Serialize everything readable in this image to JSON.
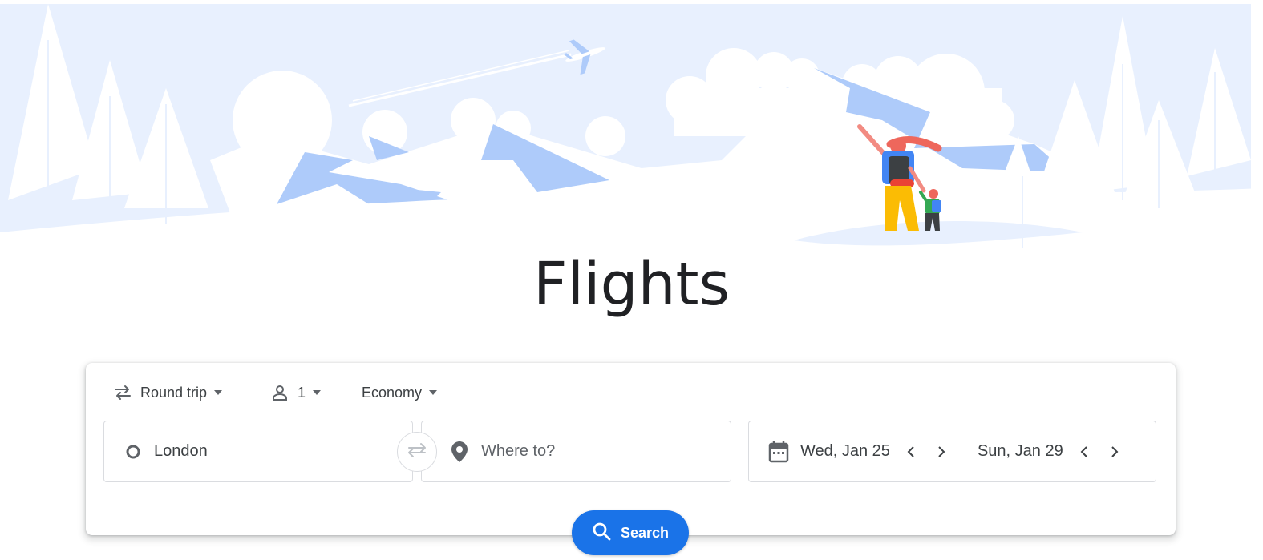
{
  "page": {
    "title": "Flights"
  },
  "trip_type": {
    "label": "Round trip",
    "icon": "swap-arrows-icon"
  },
  "passengers": {
    "count": "1",
    "icon": "person-icon"
  },
  "cabin_class": {
    "label": "Economy"
  },
  "origin": {
    "value": "London",
    "icon": "origin-circle-icon"
  },
  "destination": {
    "placeholder": "Where to?",
    "icon": "location-pin-icon"
  },
  "dates": {
    "departure": "Wed, Jan 25",
    "return": "Sun, Jan 29",
    "icon": "calendar-icon"
  },
  "search_button": {
    "label": "Search",
    "icon": "search-icon"
  },
  "colors": {
    "accent": "#1a73e8",
    "hero_sky": "#e8f0fe",
    "hero_mountain": "#aecbfa",
    "text": "#3c4043"
  }
}
